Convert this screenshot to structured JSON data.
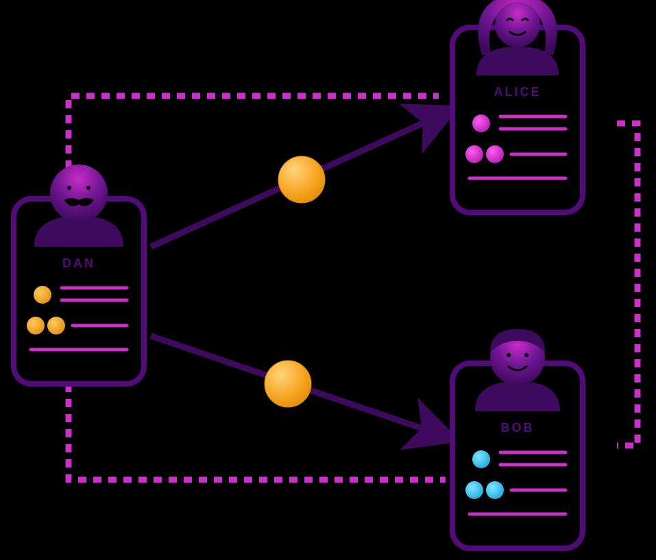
{
  "diagram": {
    "nodes": {
      "dan": {
        "label": "DAN",
        "role": "sender",
        "dot_color": "#F5A623",
        "pos": "left"
      },
      "alice": {
        "label": "ALICE",
        "role": "recipient",
        "dot_color": "#D63BC7",
        "pos": "top-right"
      },
      "bob": {
        "label": "BOB",
        "role": "recipient",
        "dot_color": "#36C3F2",
        "pos": "bottom-right"
      }
    },
    "edges": [
      {
        "from": "dan",
        "to": "alice",
        "style": "solid-arrow",
        "token": true
      },
      {
        "from": "dan",
        "to": "bob",
        "style": "solid-arrow",
        "token": true
      },
      {
        "from": "dan",
        "to": "alice",
        "style": "dotted-path",
        "token": false
      },
      {
        "from": "dan",
        "to": "bob",
        "style": "dotted-path",
        "token": false
      },
      {
        "from": "alice",
        "to": "bob",
        "style": "dotted-path",
        "token": false
      }
    ],
    "colors": {
      "card_stroke": "#520C7A",
      "icon_dark": "#3E0A5E",
      "accent": "#BF2BBF",
      "dotted": "#C931C9",
      "token_fill": "#F6A623",
      "token_edge": "#E08A00",
      "bg": "#000000"
    }
  }
}
